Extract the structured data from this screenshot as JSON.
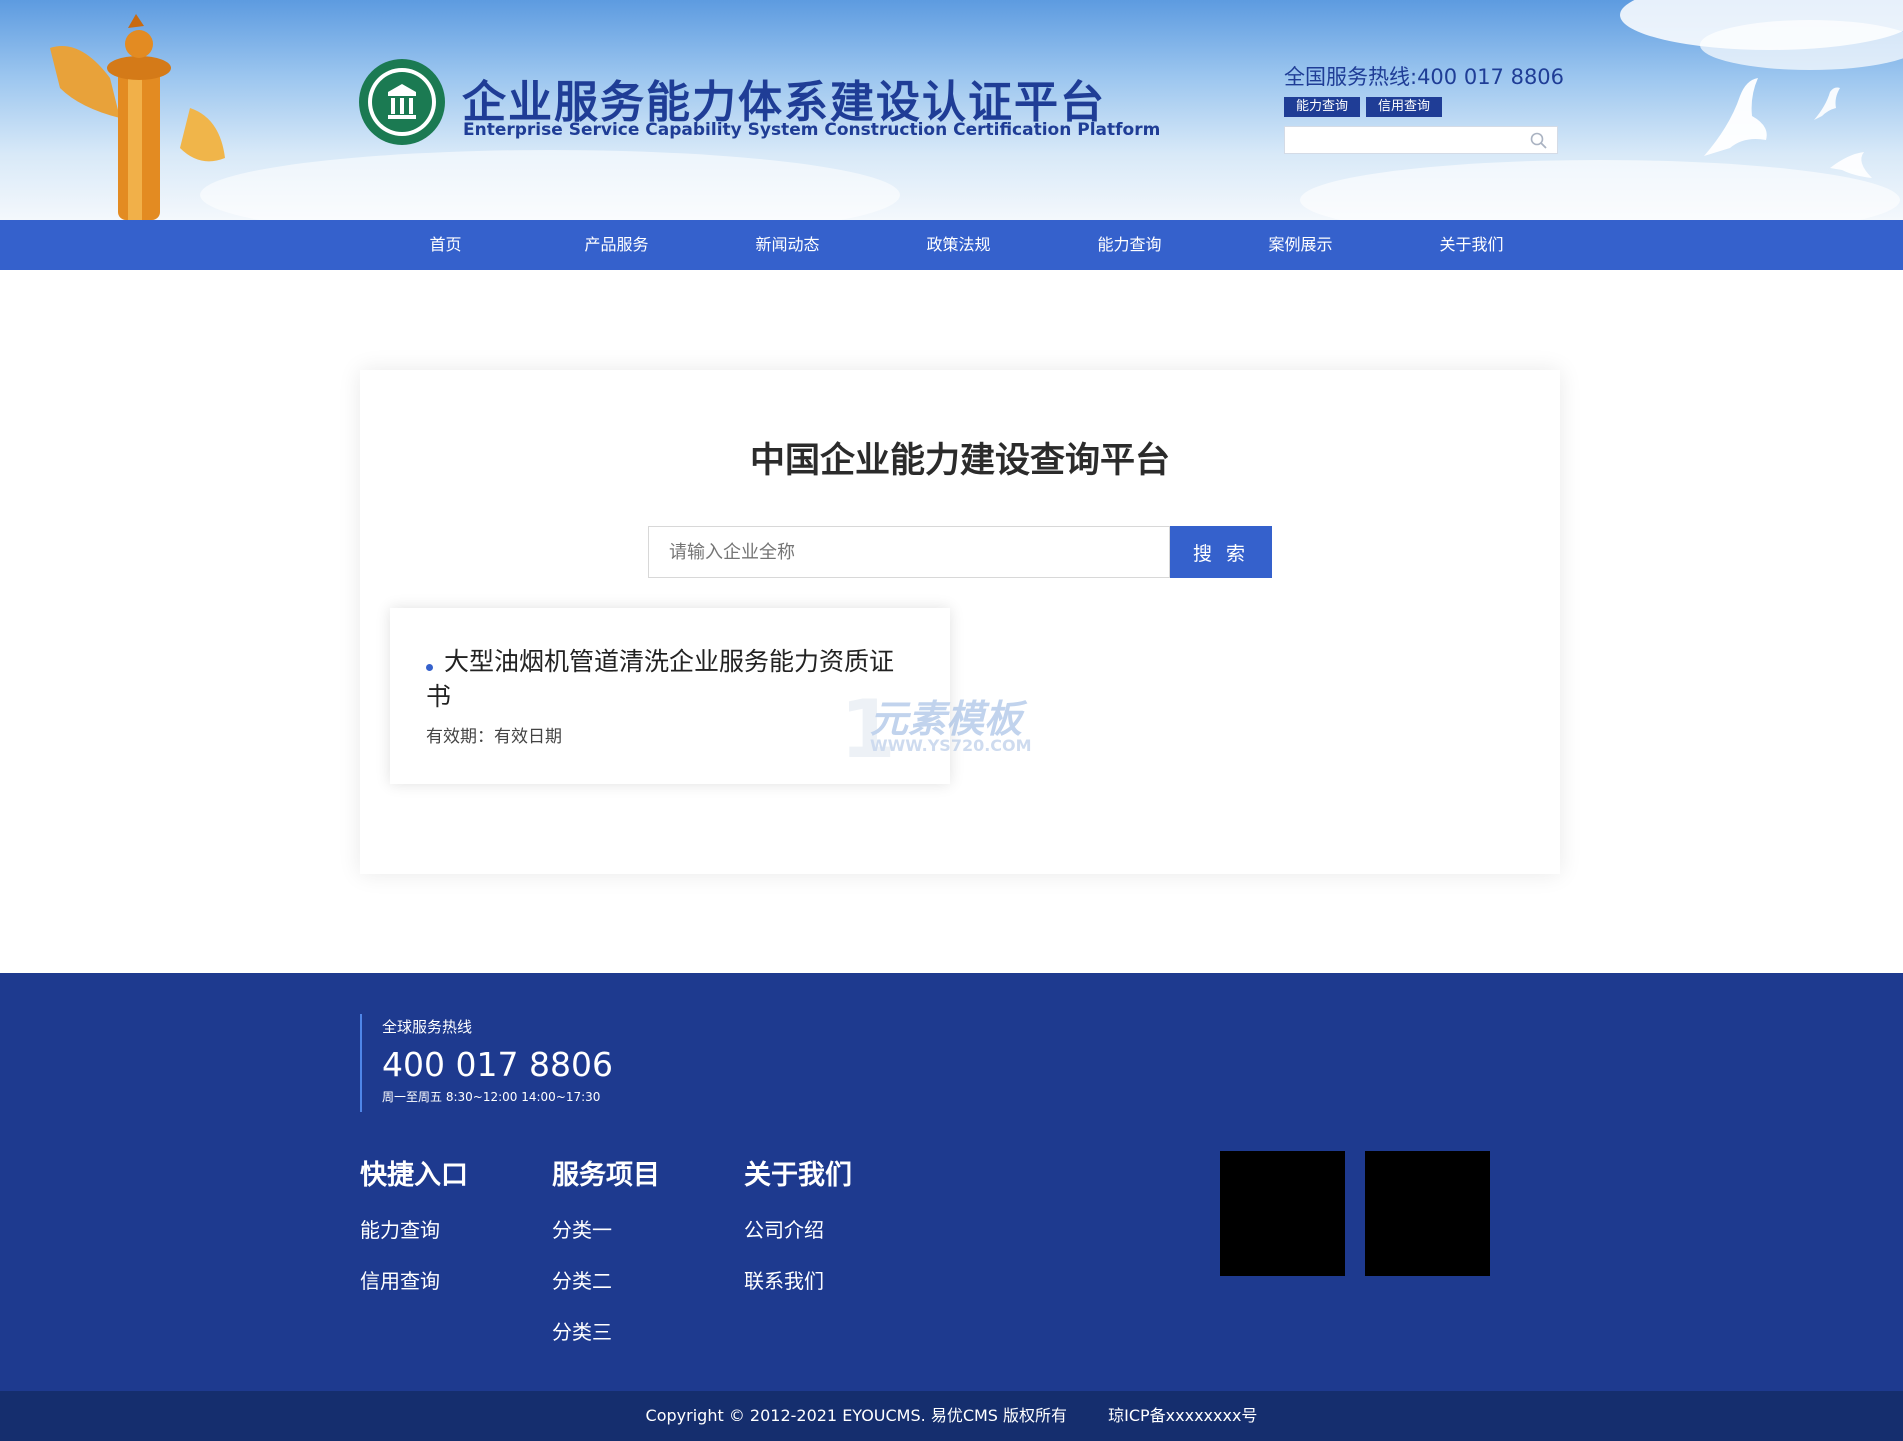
{
  "header": {
    "title": "企业服务能力体系建设认证平台",
    "subtitle": "Enterprise Service Capability System Construction Certification Platform",
    "hotline": "全国服务热线:400 017 8806",
    "quick_tabs": [
      "能力查询",
      "信用查询"
    ],
    "search_placeholder": ""
  },
  "nav": [
    "首页",
    "产品服务",
    "新闻动态",
    "政策法规",
    "能力查询",
    "案例展示",
    "关于我们"
  ],
  "main": {
    "title": "中国企业能力建设查询平台",
    "search_placeholder": "请输入企业全称",
    "search_button": "搜 索",
    "result": {
      "title": "大型油烟机管道清洗企业服务能力资质证书",
      "validity": "有效期：有效日期"
    },
    "watermark": {
      "name": "元素模板",
      "url": "WWW.YS720.COM"
    }
  },
  "footer": {
    "hotline_label": "全球服务热线",
    "hotline_number": "400 017 8806",
    "hours": "周一至周五 8:30~12:00 14:00~17:30",
    "columns": [
      {
        "title": "快捷入口",
        "links": [
          "能力查询",
          "信用查询"
        ]
      },
      {
        "title": "服务项目",
        "links": [
          "分类一",
          "分类二",
          "分类三"
        ]
      },
      {
        "title": "关于我们",
        "links": [
          "公司介绍",
          "联系我们"
        ]
      }
    ],
    "copyright": "Copyright © 2012-2021 EYOUCMS. 易优CMS 版权所有",
    "icp": "琼ICP备xxxxxxxx号"
  },
  "colors": {
    "brand": "#1f3d96",
    "nav": "#3561cc",
    "footer": "#1e3a8f",
    "footer_bottom": "#152e6e"
  }
}
